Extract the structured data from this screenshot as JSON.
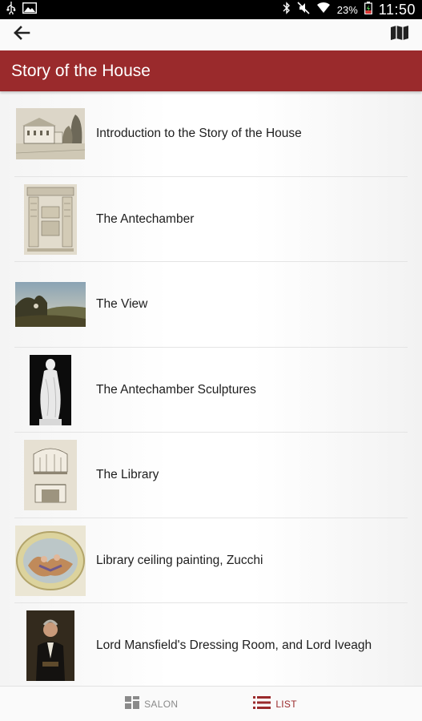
{
  "status_bar": {
    "battery_percent": "23%",
    "time": "11:50"
  },
  "app_bar": {
    "back_icon": "arrow-left-icon",
    "map_icon": "map-icon"
  },
  "title": "Story of the House",
  "items": [
    {
      "label": "Introduction to the Story of the House",
      "thumbnail": "engraving-house-thumbnail"
    },
    {
      "label": "The Antechamber",
      "thumbnail": "architectural-drawing-thumbnail"
    },
    {
      "label": "The View",
      "thumbnail": "landscape-painting-thumbnail"
    },
    {
      "label": "The Antechamber Sculptures",
      "thumbnail": "sculpture-photo-thumbnail"
    },
    {
      "label": "The Library",
      "thumbnail": "library-drawing-thumbnail"
    },
    {
      "label": "Library ceiling painting, Zucchi",
      "thumbnail": "ceiling-painting-thumbnail"
    },
    {
      "label": "Lord Mansfield's Dressing Room, and Lord Iveagh",
      "thumbnail": "portrait-painting-thumbnail"
    }
  ],
  "bottom_nav": {
    "salon": {
      "label": "SALON",
      "icon": "grid-icon",
      "active": false
    },
    "list": {
      "label": "LIST",
      "icon": "list-icon",
      "active": true
    }
  },
  "colors": {
    "accent": "#9a2a2c",
    "status_bar": "#000000",
    "inactive_tab": "#8a8a8a"
  }
}
